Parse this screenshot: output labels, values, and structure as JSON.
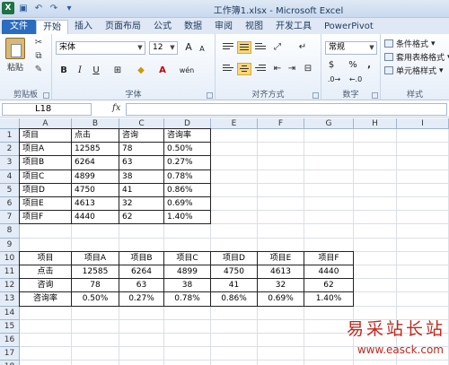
{
  "window": {
    "title": "工作簿1.xlsx - Microsoft Excel",
    "logo": "X"
  },
  "quick_access": [
    "save-icon",
    "undo-icon",
    "redo-icon",
    "customize-icon"
  ],
  "tabs": [
    {
      "label": "文件",
      "kind": "file"
    },
    {
      "label": "开始",
      "kind": "active"
    },
    {
      "label": "插入",
      "kind": ""
    },
    {
      "label": "页面布局",
      "kind": ""
    },
    {
      "label": "公式",
      "kind": ""
    },
    {
      "label": "数据",
      "kind": ""
    },
    {
      "label": "审阅",
      "kind": ""
    },
    {
      "label": "视图",
      "kind": ""
    },
    {
      "label": "开发工具",
      "kind": ""
    },
    {
      "label": "PowerPivot",
      "kind": ""
    }
  ],
  "ribbon": {
    "clipboard": {
      "paste": "粘贴",
      "label": "剪贴板"
    },
    "font": {
      "name": "宋体",
      "size": "12",
      "label": "字体",
      "bold": "B",
      "italic": "I",
      "underline": "U",
      "grow": "A",
      "shrink": "A",
      "fontcolor": "A",
      "phonetic": "wén"
    },
    "alignment": {
      "label": "对齐方式"
    },
    "number": {
      "format": "常规",
      "label": "数字",
      "percent": "%",
      "comma": ","
    },
    "styles": {
      "conditional": "条件格式",
      "table": "套用表格格式",
      "cell": "单元格样式",
      "label": "样式"
    }
  },
  "formula_bar": {
    "cell_ref": "L18",
    "fx": "fx",
    "value": ""
  },
  "columns": [
    "A",
    "B",
    "C",
    "D",
    "E",
    "F",
    "G",
    "H",
    "I"
  ],
  "rows": [
    "1",
    "2",
    "3",
    "4",
    "5",
    "6",
    "7",
    "8",
    "9",
    "10",
    "11",
    "12",
    "13",
    "14",
    "15",
    "16",
    "17",
    "18"
  ],
  "table1": {
    "header": [
      "项目",
      "点击",
      "咨询",
      "咨询率"
    ],
    "rows": [
      [
        "项目A",
        "12585",
        "78",
        "0.50%"
      ],
      [
        "项目B",
        "6264",
        "63",
        "0.27%"
      ],
      [
        "项目C",
        "4899",
        "38",
        "0.78%"
      ],
      [
        "项目D",
        "4750",
        "41",
        "0.86%"
      ],
      [
        "项目E",
        "4613",
        "32",
        "0.69%"
      ],
      [
        "项目F",
        "4440",
        "62",
        "1.40%"
      ]
    ]
  },
  "table2": {
    "header": [
      "项目",
      "项目A",
      "项目B",
      "项目C",
      "项目D",
      "项目E",
      "项目F"
    ],
    "rows": [
      [
        "点击",
        "12585",
        "6264",
        "4899",
        "4750",
        "4613",
        "4440"
      ],
      [
        "咨询",
        "78",
        "63",
        "38",
        "41",
        "32",
        "62"
      ],
      [
        "咨询率",
        "0.50%",
        "0.27%",
        "0.78%",
        "0.86%",
        "0.69%",
        "1.40%"
      ]
    ]
  },
  "watermark": {
    "text": "易采站长站",
    "sub": "www.easck.com"
  }
}
